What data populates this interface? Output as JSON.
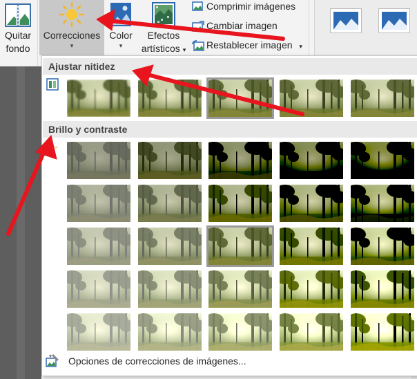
{
  "ribbon": {
    "remove_bg_line1": "Quitar",
    "remove_bg_line2": "fondo",
    "corrections": "Correcciones",
    "color": "Color",
    "effects_line1": "Efectos",
    "effects_line2": "artísticos",
    "compress": "Comprimir imágenes",
    "change": "Cambiar imagen",
    "reset": "Restablecer imagen",
    "caret": "▾"
  },
  "gallery": {
    "sharpen_title": "Ajustar nitidez",
    "brightness_title": "Brillo y contraste",
    "footer": "Opciones de correcciones de imágenes...",
    "sharpen_levels": [
      -0.4,
      -0.2,
      0,
      0.2,
      0.4
    ],
    "brightness_rows": [
      -0.4,
      -0.2,
      0,
      0.2,
      0.4
    ],
    "contrast_cols": [
      -0.4,
      -0.2,
      0,
      0.2,
      0.4
    ],
    "sharpen_selected_index": 2,
    "brightness_selected": [
      2,
      2
    ]
  },
  "colors": {
    "accent_arrow": "#e8141e",
    "selected_bg": "#c8c8c8"
  }
}
